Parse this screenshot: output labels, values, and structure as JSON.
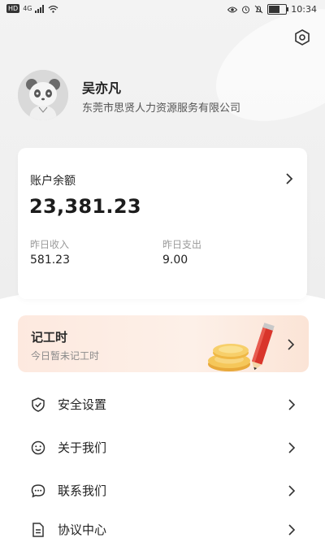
{
  "status_bar": {
    "network": "4G",
    "time": "10:34"
  },
  "profile": {
    "name": "吴亦凡",
    "company": "东莞市思贤人力资源服务有限公司"
  },
  "balance": {
    "label": "账户余额",
    "amount": "23,381.23",
    "yesterday_income_label": "昨日收入",
    "yesterday_income": "581.23",
    "yesterday_expense_label": "昨日支出",
    "yesterday_expense": "9.00"
  },
  "banner": {
    "title": "记工时",
    "subtitle": "今日暂未记工时"
  },
  "menu": [
    {
      "label": "安全设置",
      "icon": "shield-check-icon"
    },
    {
      "label": "关于我们",
      "icon": "smiley-icon"
    },
    {
      "label": "联系我们",
      "icon": "chat-bubble-icon"
    },
    {
      "label": "协议中心",
      "icon": "document-icon"
    }
  ],
  "colors": {
    "accent_red": "#d9352b",
    "gold": "#f2b33a",
    "banner_bg": "#fde9df"
  }
}
